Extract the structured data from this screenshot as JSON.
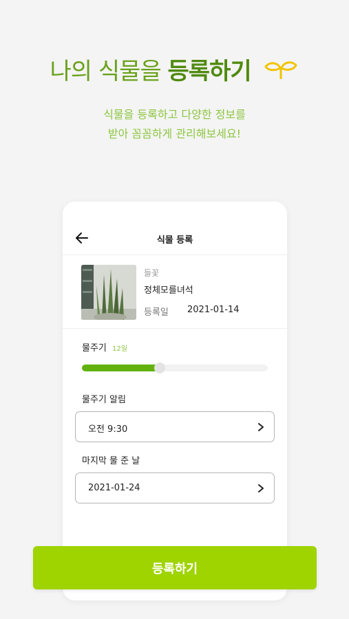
{
  "hero": {
    "title_part1": "나의 식물을 ",
    "title_part2": "등록하기",
    "subtitle_line1": "식물을 등록하고 다양한 정보를",
    "subtitle_line2": "받아 꼼꼼하게 관리해보세요!",
    "icon": "sprout-icon",
    "accent_color": "#6aa11c",
    "icon_color": "#f2c400"
  },
  "card": {
    "title": "식물 등록",
    "back_icon": "arrow-left-icon"
  },
  "plant": {
    "type": "들꽃",
    "name": "정체모를녀석",
    "registered_label": "등록일",
    "registered_date": "2021-01-14"
  },
  "watering": {
    "label": "물주기",
    "interval": "12일",
    "progress_fraction": 0.42,
    "fill_color": "#62b10e"
  },
  "alarm": {
    "label": "물주기 알림",
    "value": "오전 9:30",
    "icon": "chevron-right-icon"
  },
  "last_watered": {
    "label": "마지막 물 준 날",
    "value": "2021-01-24",
    "icon": "chevron-right-icon"
  },
  "cta": {
    "label": "등록하기",
    "color": "#9fd400"
  }
}
